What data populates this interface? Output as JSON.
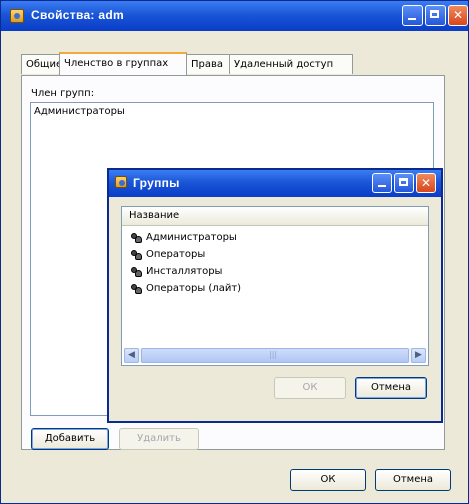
{
  "window": {
    "title": "Свойства: adm",
    "tabs": [
      "Общие",
      "Членство в группах",
      "Права",
      "Удаленный доступ"
    ],
    "active_tab": 1,
    "member_of_label": "Член групп:",
    "members": [
      "Администраторы"
    ],
    "add_label": "Добавить",
    "remove_label": "Удалить",
    "ok_label": "ОК",
    "cancel_label": "Отмена"
  },
  "groups_dialog": {
    "title": "Группы",
    "column_header": "Название",
    "items": [
      "Администраторы",
      "Операторы",
      "Инсталляторы",
      "Операторы (лайт)"
    ],
    "ok_label": "ОК",
    "cancel_label": "Отмена"
  }
}
